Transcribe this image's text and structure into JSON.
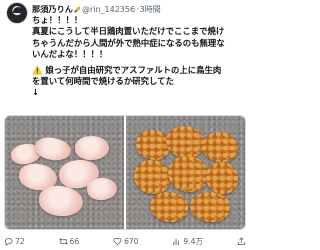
{
  "author": {
    "display_name": "那須乃りん",
    "handle": "@rin_142356",
    "separator": "·",
    "time": "3時間"
  },
  "tweet": {
    "lines": [
      "ちょ！！！！",
      "真夏にこうして半日鶏肉置いただけでここまで焼け",
      "ちゃうんだから人間が外で熱中症になるのも無理な",
      "いんだよな！！！！",
      "",
      "⚠️ 娘っ子が自由研究でアスファルトの上に鳥生肉",
      "を置いて何時間で焼けるか研究してた",
      "↓"
    ]
  },
  "media": {
    "left_alt": "raw chicken on asphalt",
    "right_alt": "cooked chicken on asphalt"
  },
  "actions": {
    "reply_count": "72",
    "retweet_count": "66",
    "like_count": "670",
    "views_count": "9.4万"
  },
  "colors": {
    "text": "#0f1419",
    "muted": "#536471",
    "asphalt": "#8f8c8a"
  }
}
